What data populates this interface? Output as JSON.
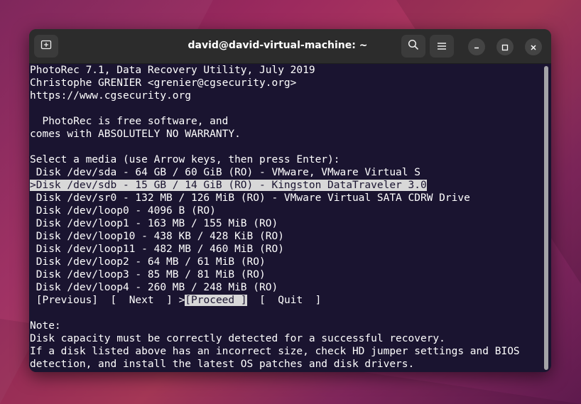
{
  "window": {
    "title": "david@david-virtual-machine: ~"
  },
  "terminal": {
    "header": [
      "PhotoRec 7.1, Data Recovery Utility, July 2019",
      "Christophe GRENIER <grenier@cgsecurity.org>",
      "https://www.cgsecurity.org"
    ],
    "license": [
      "  PhotoRec is free software, and",
      "comes with ABSOLUTELY NO WARRANTY."
    ],
    "prompt": "Select a media (use Arrow keys, then press Enter):",
    "media": [
      {
        "text": " Disk /dev/sda - 64 GB / 60 GiB (RO) - VMware, VMware Virtual S",
        "selected": false
      },
      {
        "text": ">Disk /dev/sdb - 15 GB / 14 GiB (RO) - Kingston DataTraveler 3.0",
        "selected": true
      },
      {
        "text": " Disk /dev/sr0 - 132 MB / 126 MiB (RO) - VMware Virtual SATA CDRW Drive",
        "selected": false
      },
      {
        "text": " Disk /dev/loop0 - 4096 B (RO)",
        "selected": false
      },
      {
        "text": " Disk /dev/loop1 - 163 MB / 155 MiB (RO)",
        "selected": false
      },
      {
        "text": " Disk /dev/loop10 - 438 KB / 428 KiB (RO)",
        "selected": false
      },
      {
        "text": " Disk /dev/loop11 - 482 MB / 460 MiB (RO)",
        "selected": false
      },
      {
        "text": " Disk /dev/loop2 - 64 MB / 61 MiB (RO)",
        "selected": false
      },
      {
        "text": " Disk /dev/loop3 - 85 MB / 81 MiB (RO)",
        "selected": false
      },
      {
        "text": " Disk /dev/loop4 - 260 MB / 248 MiB (RO)",
        "selected": false
      }
    ],
    "actions": {
      "previous": "[Previous]",
      "next": "[  Next  ]",
      "proceed_marker": ">",
      "proceed": "[Proceed ]",
      "quit": "[  Quit  ]"
    },
    "note": [
      "Note:",
      "Disk capacity must be correctly detected for a successful recovery.",
      "If a disk listed above has an incorrect size, check HD jumper settings and BIOS",
      "detection, and install the latest OS patches and disk drivers."
    ]
  },
  "icons": {
    "new_tab": "new-tab-icon",
    "search": "search-icon",
    "menu": "hamburger-menu-icon",
    "minimize": "minimize-icon",
    "maximize": "maximize-icon",
    "close": "close-icon"
  },
  "colors": {
    "terminal_bg": "#1a1430",
    "terminal_fg": "#ffffff",
    "selection_bg": "#d8d8d8",
    "titlebar_bg": "#2c2c2c"
  }
}
